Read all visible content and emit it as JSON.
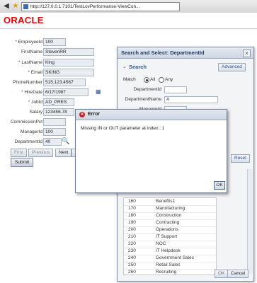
{
  "browser": {
    "url": "http://127.0.0.1:7101/TestLovPerformanse-ViewCon..."
  },
  "header": {
    "logo": "ORACLE"
  },
  "form": {
    "fields": [
      {
        "label": "EmployeeId",
        "required": true,
        "value": "100"
      },
      {
        "label": "FirstName",
        "required": false,
        "value": "StevenRR"
      },
      {
        "label": "LastName",
        "required": true,
        "value": "King"
      },
      {
        "label": "Email",
        "required": true,
        "value": "SKING"
      },
      {
        "label": "PhoneNumber",
        "required": false,
        "value": "515.123.4567"
      },
      {
        "label": "HireDate",
        "required": true,
        "value": "6/17/1987"
      },
      {
        "label": "JobId",
        "required": true,
        "value": "AD_PRES"
      },
      {
        "label": "Salary",
        "required": false,
        "value": "123456.78"
      },
      {
        "label": "CommissionPct",
        "required": false,
        "value": ""
      },
      {
        "label": "ManagerId",
        "required": false,
        "value": "100"
      },
      {
        "label": "DepartmentId",
        "required": false,
        "value": "40"
      }
    ],
    "pager": {
      "first": "First",
      "previous": "Previous",
      "next": "Next",
      "last": "L"
    },
    "submit": "Submit"
  },
  "lov": {
    "title": "Search and Select: DepartmentId",
    "search_heading": "Search",
    "advanced": "Advanced",
    "match_label": "Match",
    "match_all": "All",
    "match_any": "Any",
    "department_id_label": "DepartmentId",
    "department_name_label": "DepartmentName",
    "department_name_value": "A",
    "manager_id_label": "ManagerId",
    "reset": "Reset",
    "rows": [
      {
        "id": "160",
        "name": "Benefits1"
      },
      {
        "id": "170",
        "name": "Manufacturing"
      },
      {
        "id": "180",
        "name": "Construction"
      },
      {
        "id": "190",
        "name": "Contracting"
      },
      {
        "id": "200",
        "name": "Operations"
      },
      {
        "id": "210",
        "name": "IT Support"
      },
      {
        "id": "220",
        "name": "NOC"
      },
      {
        "id": "230",
        "name": "IT Helpdesk"
      },
      {
        "id": "240",
        "name": "Government Sales"
      },
      {
        "id": "250",
        "name": "Retail Sales"
      },
      {
        "id": "260",
        "name": "Recruiting"
      }
    ],
    "ok": "OK",
    "cancel": "Cancel"
  },
  "error": {
    "title": "Error",
    "message": "Missing IN or OUT parameter at index:: 1",
    "ok": "OK"
  },
  "colors": {
    "accent": "#2b5797",
    "brand": "#e00000",
    "error": "#c81d1d"
  }
}
